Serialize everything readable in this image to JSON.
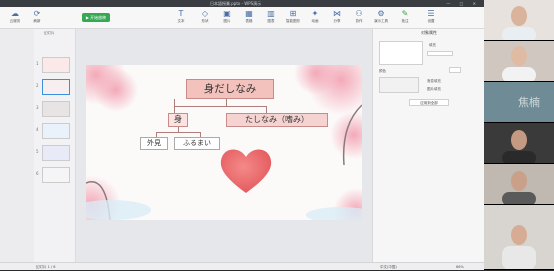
{
  "window": {
    "title": "日本語授業.pptx - WPS演示",
    "controls": "— □ ✕"
  },
  "toolbar": {
    "items": [
      {
        "label": "云服务",
        "icon": "cloud-icon"
      },
      {
        "label": "刷新",
        "icon": "refresh-icon"
      },
      {
        "label": "文本",
        "icon": "text-icon"
      },
      {
        "label": "形状",
        "icon": "shape-icon"
      },
      {
        "label": "图片",
        "icon": "image-icon"
      },
      {
        "label": "表格",
        "icon": "table-icon"
      },
      {
        "label": "图表",
        "icon": "chart-icon"
      },
      {
        "label": "智能图形",
        "icon": "smartart-icon"
      },
      {
        "label": "动画",
        "icon": "animation-icon"
      },
      {
        "label": "分享",
        "icon": "share-icon"
      },
      {
        "label": "协作",
        "icon": "collab-icon"
      },
      {
        "label": "演示工具",
        "icon": "tools-icon"
      },
      {
        "label": "批注",
        "icon": "comment-icon"
      },
      {
        "label": "设置",
        "icon": "settings-icon"
      }
    ],
    "play_label": "▶ 开始放映"
  },
  "left_panel": {
    "header": "幻灯片",
    "slides": [
      "1",
      "2",
      "3",
      "4",
      "5",
      "6"
    ]
  },
  "slide": {
    "title": "身だしなみ",
    "node_left": "身",
    "node_right": "たしなみ（嗜み）",
    "leaf_1": "外見",
    "leaf_2": "ふるまい"
  },
  "right_panel": {
    "title": "对象属性",
    "fill_label": "填充",
    "color_label": "颜色",
    "opt_1": "渐变填充",
    "opt_2": "图片填充",
    "apply_label": "应用到全部"
  },
  "status": {
    "left": "幻灯片 1 / 6",
    "right": "中文(中国)",
    "zoom": "66%"
  },
  "participants": [
    {
      "name": ""
    },
    {
      "name": ""
    },
    {
      "name": "焦楠"
    },
    {
      "name": ""
    },
    {
      "name": ""
    },
    {
      "name": ""
    }
  ]
}
